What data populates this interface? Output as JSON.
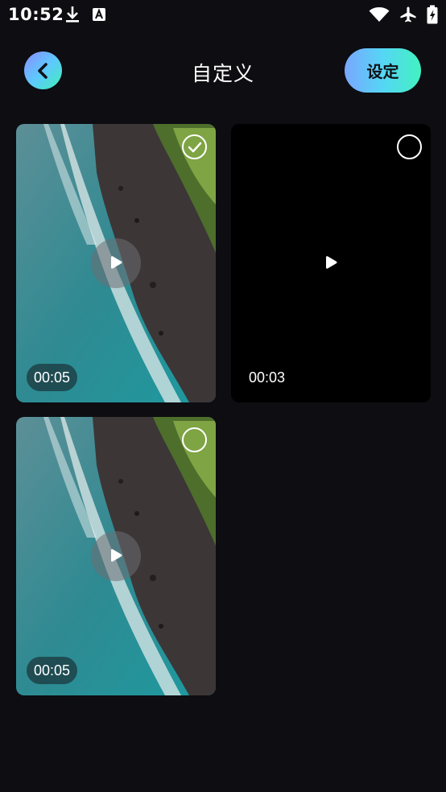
{
  "status_bar": {
    "time": "10:52",
    "left_icons": [
      "download-icon",
      "font-a-icon"
    ],
    "right_icons": [
      "wifi-icon",
      "airplane-icon",
      "battery-icon"
    ]
  },
  "header": {
    "title": "自定义",
    "back_icon": "chevron-left-icon",
    "settings_label": "设定"
  },
  "colors": {
    "background": "#0d0d12",
    "accent_gradient_start": "#7aa6ff",
    "accent_gradient_end": "#42f2c0"
  },
  "videos": [
    {
      "duration": "00:05",
      "selected": true,
      "thumbnail": "aerial-coastline"
    },
    {
      "duration": "00:03",
      "selected": false,
      "thumbnail": "black"
    },
    {
      "duration": "00:05",
      "selected": false,
      "thumbnail": "aerial-coastline"
    }
  ]
}
